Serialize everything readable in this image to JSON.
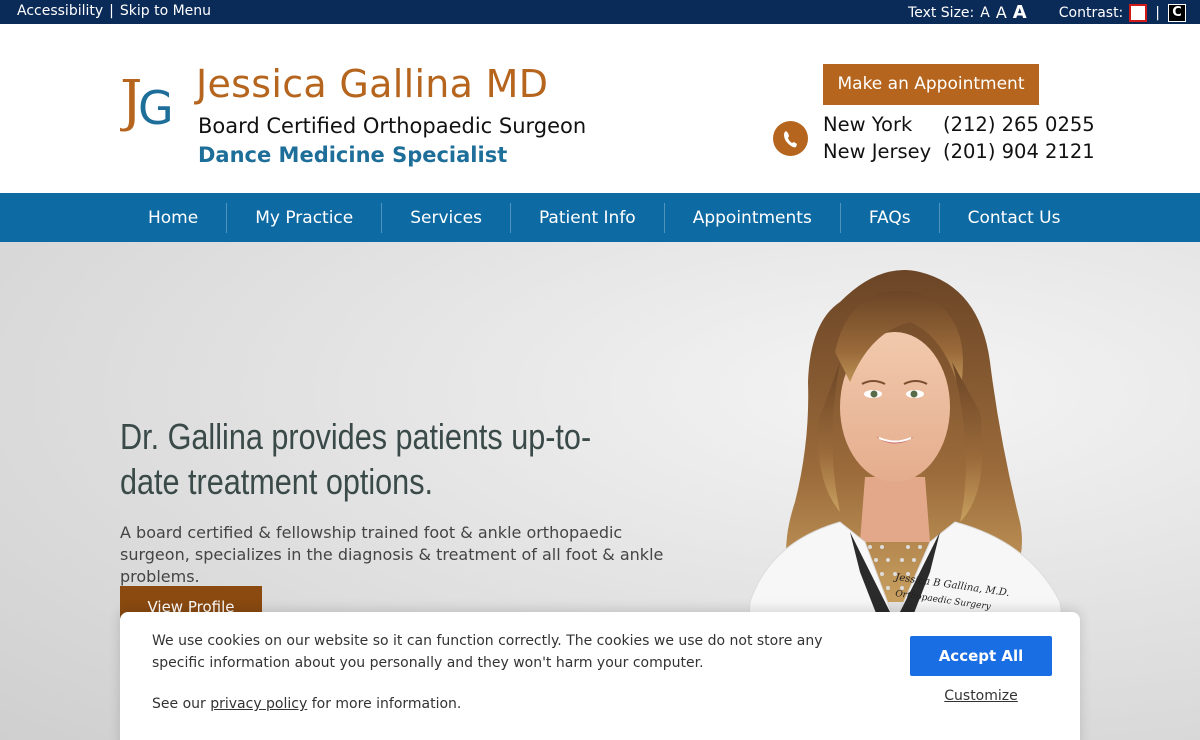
{
  "utility": {
    "accessibility": "Accessibility",
    "separator": "|",
    "skip": "Skip to Menu",
    "text_size_label": "Text Size:",
    "text_size_small": "A",
    "text_size_medium": "A",
    "text_size_large": "A",
    "contrast_label": "Contrast:",
    "contrast_light": "C",
    "contrast_dark": "C"
  },
  "header": {
    "logo_letters": "JG",
    "title": "Jessica Gallina MD",
    "subtitle1": "Board Certified Orthopaedic Surgeon",
    "subtitle2": "Dance Medicine Specialist",
    "appointment_button": "Make an Appointment",
    "phones": [
      {
        "city": "New York",
        "number": "(212) 265 0255"
      },
      {
        "city": "New Jersey",
        "number": "(201) 904 2121"
      }
    ]
  },
  "nav": {
    "items": [
      "Home",
      "My Practice",
      "Services",
      "Patient Info",
      "Appointments",
      "FAQs",
      "Contact Us"
    ]
  },
  "hero": {
    "title": "Dr. Gallina provides patients up-to-date treatment options.",
    "text": "A board certified & fellowship trained foot & ankle orthopaedic surgeon, specializes in the diagnosis & treatment of all foot & ankle problems.",
    "button": "View Profile",
    "coat_embroidery_line1": "Jessica B Gallina, M.D.",
    "coat_embroidery_line2": "Orthopaedic Surgery"
  },
  "cookie": {
    "text": "We use cookies on our website so it can function correctly. The cookies we use do not store any specific information about you personally and they won't harm your computer.",
    "see_our": "See our",
    "privacy_link": "privacy policy",
    "more_info": "for more information.",
    "accept": "Accept All",
    "customize": "Customize"
  },
  "colors": {
    "utility_bar": "#0a2a57",
    "brand_orange": "#b5651d",
    "nav_blue": "#0e6aa3",
    "subtitle_blue": "#1e6e9a",
    "accept_blue": "#1a6ee3"
  }
}
